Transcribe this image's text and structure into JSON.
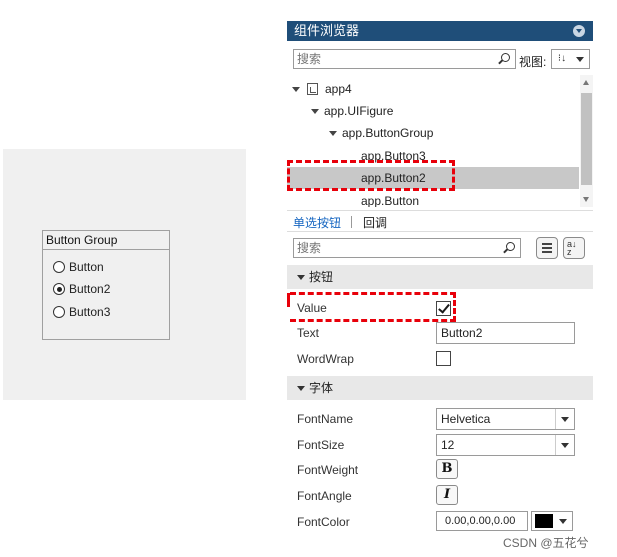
{
  "canvas": {
    "group_title": "Button Group",
    "buttons": [
      {
        "label": "Button",
        "selected": false
      },
      {
        "label": "Button2",
        "selected": true
      },
      {
        "label": "Button3",
        "selected": false
      }
    ]
  },
  "browser": {
    "title": "组件浏览器",
    "search_placeholder": "搜索",
    "view_label": "视图:",
    "tree": [
      {
        "label": "app4",
        "selected": false
      },
      {
        "label": "app.UIFigure",
        "selected": false
      },
      {
        "label": "app.ButtonGroup",
        "selected": false
      },
      {
        "label": "app.Button3",
        "selected": false
      },
      {
        "label": "app.Button2",
        "selected": true
      },
      {
        "label": "app.Button",
        "selected": false
      }
    ]
  },
  "inspector": {
    "tabs": [
      "单选按钮",
      "回调"
    ],
    "search_placeholder": "搜索",
    "sections": [
      {
        "title": "按钮",
        "props": [
          {
            "name": "Value",
            "checked": true
          },
          {
            "name": "Text",
            "value": "Button2"
          },
          {
            "name": "WordWrap",
            "checked": false
          }
        ]
      },
      {
        "title": "字体",
        "props": [
          {
            "name": "FontName",
            "value": "Helvetica"
          },
          {
            "name": "FontSize",
            "value": "12"
          },
          {
            "name": "FontWeight",
            "button": "B"
          },
          {
            "name": "FontAngle",
            "button": "I"
          },
          {
            "name": "FontColor",
            "value": "0.00,0.00,0.00",
            "swatch": "#000000"
          }
        ]
      }
    ]
  },
  "colors": {
    "header": "#1f4e79",
    "highlight": "#e8000a",
    "selection": "#c8c8c8",
    "active_tab": "#1565c0"
  },
  "watermark": "CSDN @五花兮"
}
